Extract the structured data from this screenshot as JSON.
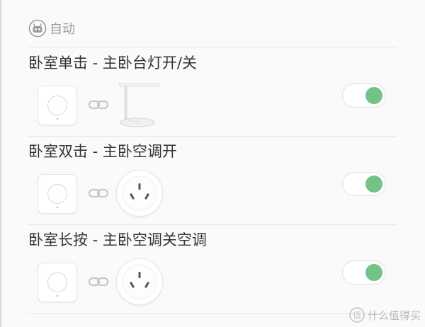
{
  "header": {
    "icon": "robot-icon",
    "label": "自动"
  },
  "automations": [
    {
      "title": "卧室单击 - 主卧台灯开/关",
      "trigger_device": "wireless-switch",
      "link_icon": "link-icon",
      "target_device": "desk-lamp",
      "enabled": true
    },
    {
      "title": "卧室双击 - 主卧空调开",
      "trigger_device": "wireless-switch",
      "link_icon": "link-icon",
      "target_device": "smart-plug",
      "enabled": true
    },
    {
      "title": "卧室长按 - 主卧空调关空调",
      "trigger_device": "wireless-switch",
      "link_icon": "link-icon",
      "target_device": "smart-plug",
      "enabled": true
    }
  ],
  "watermark": {
    "icon": "smzdm-logo-icon",
    "text": "什么值得买"
  },
  "colors": {
    "toggle_on": "#74c386",
    "divider": "#e6e6e6",
    "title_text": "#333333",
    "muted_text": "#9b9b9b"
  }
}
